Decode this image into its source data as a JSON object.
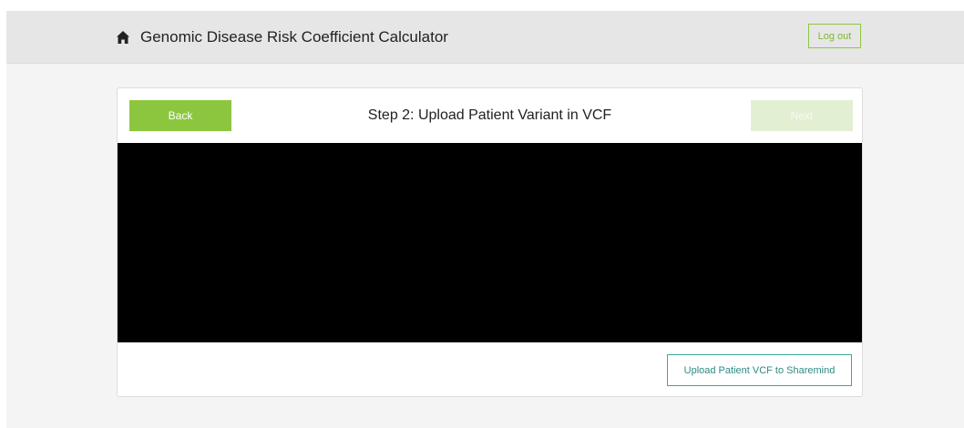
{
  "header": {
    "app_title": "Genomic Disease Risk Coefficient Calculator",
    "logout_label": "Log out",
    "home_icon": "home-icon"
  },
  "wizard": {
    "back_label": "Back",
    "step_title": "Step 2: Upload Patient Variant in VCF",
    "next_label": "Next",
    "next_disabled": true,
    "upload_label": "Upload Patient VCF to Sharemind"
  },
  "colors": {
    "accent_green": "#8cc63f",
    "disabled_green": "#e2efd3",
    "upload_border": "#3aa8a0",
    "content_bg": "#000000"
  }
}
